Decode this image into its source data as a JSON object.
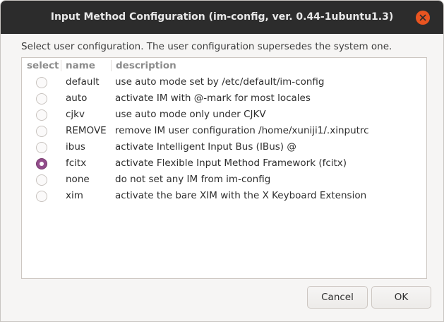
{
  "window": {
    "title": "Input Method Configuration (im-config, ver. 0.44-1ubuntu1.3)",
    "close_icon": "close-icon"
  },
  "prompt": "Select user configuration. The user configuration supersedes the system one.",
  "columns": {
    "select": "select",
    "name": "name",
    "description": "description"
  },
  "rows": [
    {
      "name": "default",
      "description": "use auto mode set by /etc/default/im-config",
      "selected": false
    },
    {
      "name": "auto",
      "description": "activate IM with @-mark for most locales",
      "selected": false
    },
    {
      "name": "cjkv",
      "description": "use auto mode only under CJKV",
      "selected": false
    },
    {
      "name": "REMOVE",
      "description": "remove IM user configuration /home/xuniji1/.xinputrc",
      "selected": false
    },
    {
      "name": "ibus",
      "description": "activate Intelligent Input Bus (IBus) @",
      "selected": false
    },
    {
      "name": "fcitx",
      "description": "activate Flexible Input Method Framework (fcitx)",
      "selected": true
    },
    {
      "name": "none",
      "description": "do not set any IM from im-config",
      "selected": false
    },
    {
      "name": "xim",
      "description": "activate the bare XIM with the X Keyboard Extension",
      "selected": false
    }
  ],
  "buttons": {
    "cancel": "Cancel",
    "ok": "OK"
  },
  "colors": {
    "titlebar": "#2c2c2c",
    "close_button": "#e95420",
    "radio_selected": "#924d8b"
  }
}
